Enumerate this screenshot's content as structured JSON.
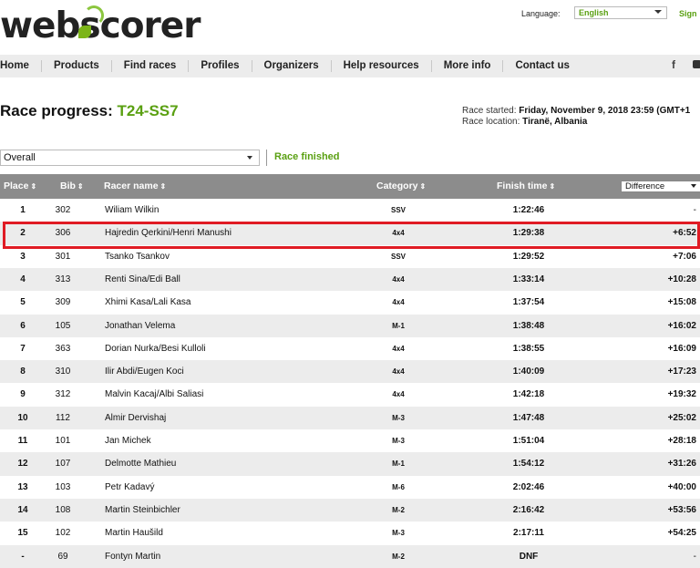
{
  "header": {
    "logo": "webscorer",
    "language_label": "Language:",
    "language_value": "English",
    "signin_label": "Sign"
  },
  "nav": {
    "items": [
      "Home",
      "Products",
      "Find races",
      "Profiles",
      "Organizers",
      "Help resources",
      "More info",
      "Contact us"
    ],
    "social_icon": "f"
  },
  "race": {
    "title_prefix": "Race progress:",
    "race_code": "T24-SS7",
    "started_label": "Race started:",
    "started_value": "Friday, November 9, 2018 23:59 (GMT+1",
    "location_label": "Race location:",
    "location_value": "Tiranë, Albania"
  },
  "filter": {
    "selected": "Overall",
    "status": "Race finished"
  },
  "table": {
    "columns": {
      "place": "Place",
      "bib": "Bib",
      "name": "Racer name",
      "category": "Category",
      "finish": "Finish time",
      "difference_select": "Difference"
    },
    "sort_glyph": "⇕",
    "rows": [
      {
        "place": "1",
        "bib": "302",
        "name": "Wiliam Wilkin",
        "category": "SSV",
        "finish": "1:22:46",
        "diff": "-"
      },
      {
        "place": "2",
        "bib": "306",
        "name": "Hajredin Qerkini/Henri Manushi",
        "category": "4x4",
        "finish": "1:29:38",
        "diff": "+6:52"
      },
      {
        "place": "3",
        "bib": "301",
        "name": "Tsanko Tsankov",
        "category": "SSV",
        "finish": "1:29:52",
        "diff": "+7:06"
      },
      {
        "place": "4",
        "bib": "313",
        "name": "Renti Sina/Edi Ball",
        "category": "4x4",
        "finish": "1:33:14",
        "diff": "+10:28"
      },
      {
        "place": "5",
        "bib": "309",
        "name": "Xhimi Kasa/Lali Kasa",
        "category": "4x4",
        "finish": "1:37:54",
        "diff": "+15:08"
      },
      {
        "place": "6",
        "bib": "105",
        "name": "Jonathan Velema",
        "category": "M-1",
        "finish": "1:38:48",
        "diff": "+16:02"
      },
      {
        "place": "7",
        "bib": "363",
        "name": "Dorian Nurka/Besi Kulloli",
        "category": "4x4",
        "finish": "1:38:55",
        "diff": "+16:09"
      },
      {
        "place": "8",
        "bib": "310",
        "name": "Ilir Abdi/Eugen Koci",
        "category": "4x4",
        "finish": "1:40:09",
        "diff": "+17:23"
      },
      {
        "place": "9",
        "bib": "312",
        "name": "Malvin Kacaj/Albi Saliasi",
        "category": "4x4",
        "finish": "1:42:18",
        "diff": "+19:32"
      },
      {
        "place": "10",
        "bib": "112",
        "name": "Almir Dervishaj",
        "category": "M-3",
        "finish": "1:47:48",
        "diff": "+25:02"
      },
      {
        "place": "11",
        "bib": "101",
        "name": "Jan Michek",
        "category": "M-3",
        "finish": "1:51:04",
        "diff": "+28:18"
      },
      {
        "place": "12",
        "bib": "107",
        "name": "Delmotte Mathieu",
        "category": "M-1",
        "finish": "1:54:12",
        "diff": "+31:26"
      },
      {
        "place": "13",
        "bib": "103",
        "name": "Petr Kadavý",
        "category": "M-6",
        "finish": "2:02:46",
        "diff": "+40:00"
      },
      {
        "place": "14",
        "bib": "108",
        "name": "Martin Steinbichler",
        "category": "M-2",
        "finish": "2:16:42",
        "diff": "+53:56"
      },
      {
        "place": "15",
        "bib": "102",
        "name": "Martin Haušild",
        "category": "M-3",
        "finish": "2:17:11",
        "diff": "+54:25"
      },
      {
        "place": "-",
        "bib": "69",
        "name": "Fontyn Martin",
        "category": "M-2",
        "finish": "DNF",
        "diff": "-"
      }
    ]
  },
  "colors": {
    "brand_green": "#5aa012",
    "header_gray": "#8c8c8c",
    "highlight_red": "#e01b24"
  }
}
